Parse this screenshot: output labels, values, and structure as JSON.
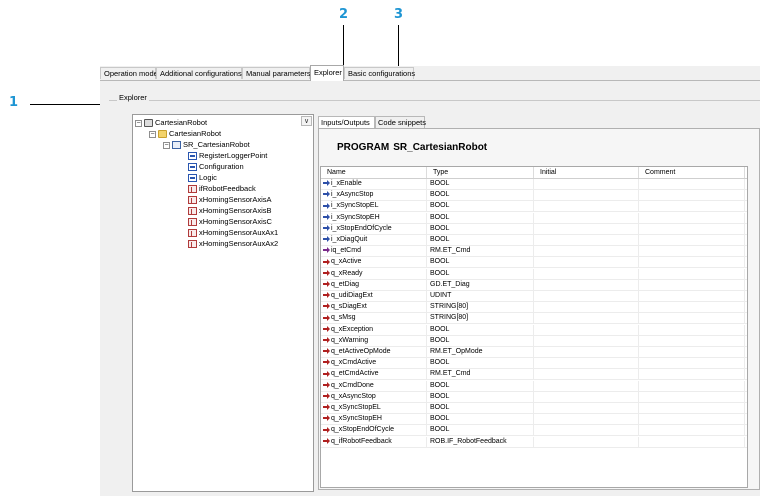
{
  "callouts": [
    "1",
    "2",
    "3"
  ],
  "tabs": [
    {
      "label": "Operation mode"
    },
    {
      "label": "Additional configurations"
    },
    {
      "label": "Manual parameters"
    },
    {
      "label": "Explorer"
    },
    {
      "label": "Basic configurations"
    }
  ],
  "active_tab": "Explorer",
  "explorer": {
    "group_label": "Explorer"
  },
  "tree": [
    {
      "label": "CartesianRobot",
      "icon": "robot-icon"
    },
    {
      "label": "CartesianRobot",
      "icon": "folder-icon"
    },
    {
      "label": "SR_CartesianRobot",
      "icon": "program-icon"
    },
    {
      "label": "RegisterLoggerPoint",
      "icon": "action-icon"
    },
    {
      "label": "Configuration",
      "icon": "action-icon"
    },
    {
      "label": "Logic",
      "icon": "action-icon"
    },
    {
      "label": "ifRobotFeedback",
      "icon": "variable-icon"
    },
    {
      "label": "xHomingSensorAxisA",
      "icon": "variable-icon"
    },
    {
      "label": "xHomingSensorAxisB",
      "icon": "variable-icon"
    },
    {
      "label": "xHomingSensorAxisC",
      "icon": "variable-icon"
    },
    {
      "label": "xHomingSensorAuxAx1",
      "icon": "variable-icon"
    },
    {
      "label": "xHomingSensorAuxAx2",
      "icon": "variable-icon"
    }
  ],
  "sub_tabs": [
    {
      "label": "Inputs/Outputs"
    },
    {
      "label": "Code snippets"
    }
  ],
  "program": {
    "keyword": "PROGRAM",
    "name": "SR_CartesianRobot"
  },
  "table": {
    "columns": [
      "Name",
      "Type",
      "Initial",
      "Comment"
    ],
    "rows": [
      {
        "dir": "in",
        "name": "i_xEnable",
        "type": "BOOL"
      },
      {
        "dir": "in",
        "name": "i_xAsyncStop",
        "type": "BOOL"
      },
      {
        "dir": "in",
        "name": "i_xSyncStopEL",
        "type": "BOOL"
      },
      {
        "dir": "in",
        "name": "i_xSyncStopEH",
        "type": "BOOL"
      },
      {
        "dir": "in",
        "name": "i_xStopEndOfCycle",
        "type": "BOOL"
      },
      {
        "dir": "in",
        "name": "i_xDiagQuit",
        "type": "BOOL"
      },
      {
        "dir": "inout",
        "name": "iq_etCmd",
        "type": "RM.ET_Cmd"
      },
      {
        "dir": "out",
        "name": "q_xActive",
        "type": "BOOL"
      },
      {
        "dir": "out",
        "name": "q_xReady",
        "type": "BOOL"
      },
      {
        "dir": "out",
        "name": "q_etDiag",
        "type": "GD.ET_Diag"
      },
      {
        "dir": "out",
        "name": "q_udiDiagExt",
        "type": "UDINT"
      },
      {
        "dir": "out",
        "name": "q_sDiagExt",
        "type": "STRING[80]"
      },
      {
        "dir": "out",
        "name": "q_sMsg",
        "type": "STRING[80]"
      },
      {
        "dir": "out",
        "name": "q_xException",
        "type": "BOOL"
      },
      {
        "dir": "out",
        "name": "q_xWarning",
        "type": "BOOL"
      },
      {
        "dir": "out",
        "name": "q_etActiveOpMode",
        "type": "RM.ET_OpMode"
      },
      {
        "dir": "out",
        "name": "q_xCmdActive",
        "type": "BOOL"
      },
      {
        "dir": "out",
        "name": "q_etCmdActive",
        "type": "RM.ET_Cmd"
      },
      {
        "dir": "out",
        "name": "q_xCmdDone",
        "type": "BOOL"
      },
      {
        "dir": "out",
        "name": "q_xAsyncStop",
        "type": "BOOL"
      },
      {
        "dir": "out",
        "name": "q_xSyncStopEL",
        "type": "BOOL"
      },
      {
        "dir": "out",
        "name": "q_xSyncStopEH",
        "type": "BOOL"
      },
      {
        "dir": "out",
        "name": "q_xStopEndOfCycle",
        "type": "BOOL"
      },
      {
        "dir": "out",
        "name": "q_ifRobotFeedback",
        "type": "ROB.IF_RobotFeedback"
      }
    ]
  },
  "colors": {
    "callout": "#1e95d3"
  }
}
